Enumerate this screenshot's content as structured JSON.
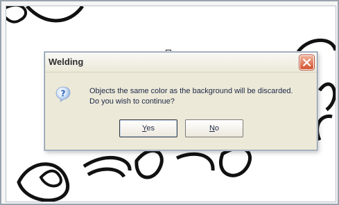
{
  "dialog": {
    "title": "Welding",
    "message_line1": "Objects the same color as the background will be discarded.",
    "message_line2": "Do you wish to continue?",
    "buttons": {
      "yes": {
        "mnemonic": "Y",
        "rest": "es"
      },
      "no": {
        "mnemonic": "N",
        "rest": "o"
      }
    }
  },
  "icons": {
    "close": "close-icon",
    "question": "question-icon"
  },
  "colors": {
    "dialog_background": "#ece9d8",
    "close_button": "#d5512c",
    "text": "#1b2745",
    "question_icon": "#2a5fb8"
  }
}
